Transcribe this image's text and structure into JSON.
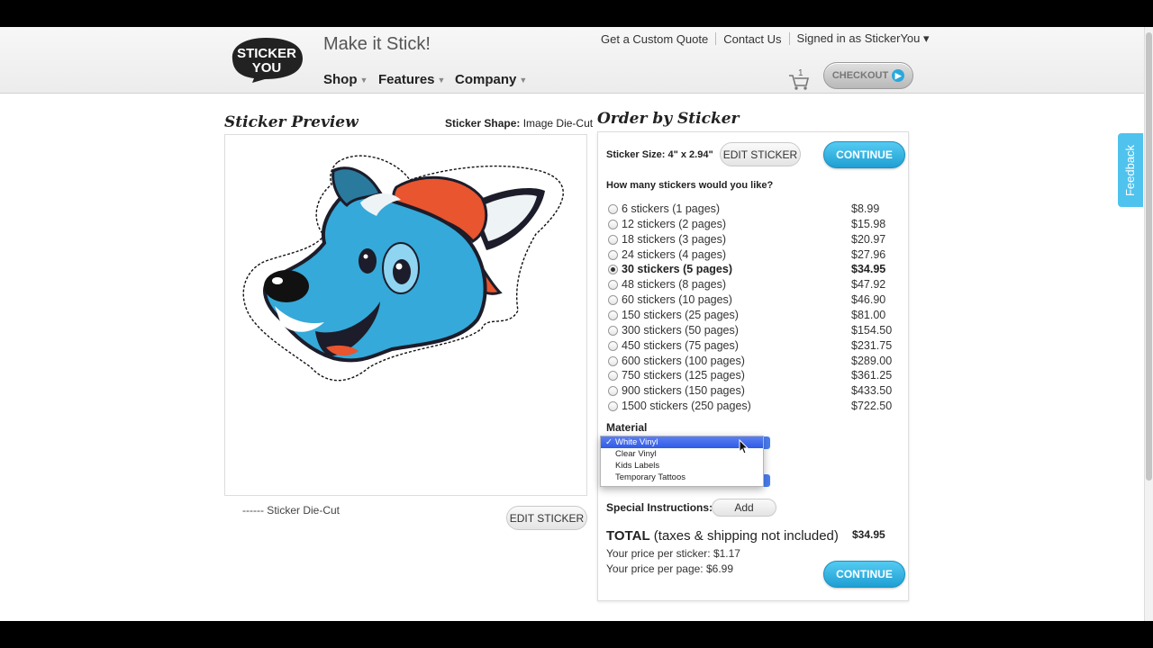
{
  "brand": {
    "logo_line1": "STICKER",
    "logo_line2": "YOU",
    "tagline": "Make it Stick!"
  },
  "nav": {
    "shop": "Shop",
    "features": "Features",
    "company": "Company"
  },
  "top_links": {
    "quote": "Get a Custom Quote",
    "contact": "Contact Us",
    "signed_in": "Signed in as StickerYou ▾"
  },
  "cart": {
    "count": "1",
    "checkout_label": "CHECKOUT"
  },
  "feedback_label": "Feedback",
  "preview": {
    "title": "Sticker Preview",
    "shape_key": "Sticker Shape:",
    "shape_value": "Image Die-Cut",
    "legend": "------ Sticker Die-Cut",
    "edit_button": "EDIT STICKER"
  },
  "order": {
    "title": "Order by Sticker",
    "size_label": "Sticker Size: 4\" x 2.94\"",
    "edit_button": "EDIT STICKER",
    "continue_label": "CONTINUE",
    "question": "How many stickers would you like?",
    "options": [
      {
        "label": "6 stickers (1 pages)",
        "price": "$8.99"
      },
      {
        "label": "12 stickers (2 pages)",
        "price": "$15.98"
      },
      {
        "label": "18 stickers (3 pages)",
        "price": "$20.97"
      },
      {
        "label": "24 stickers (4 pages)",
        "price": "$27.96"
      },
      {
        "label": "30 stickers (5 pages)",
        "price": "$34.95"
      },
      {
        "label": "48 stickers (8 pages)",
        "price": "$47.92"
      },
      {
        "label": "60 stickers (10 pages)",
        "price": "$46.90"
      },
      {
        "label": "150 stickers (25 pages)",
        "price": "$81.00"
      },
      {
        "label": "300 stickers (50 pages)",
        "price": "$154.50"
      },
      {
        "label": "450 stickers (75 pages)",
        "price": "$231.75"
      },
      {
        "label": "600 stickers (100 pages)",
        "price": "$289.00"
      },
      {
        "label": "750 stickers (125 pages)",
        "price": "$361.25"
      },
      {
        "label": "900 stickers (150 pages)",
        "price": "$433.50"
      },
      {
        "label": "1500 stickers (250 pages)",
        "price": "$722.50"
      }
    ],
    "selected_index": 4,
    "material_label": "Material",
    "material_options": [
      "White Vinyl",
      "Clear Vinyl",
      "Kids Labels",
      "Temporary Tattoos"
    ],
    "material_selected": "White Vinyl",
    "special_label": "Special Instructions:",
    "special_add": "Add",
    "total_bold": "TOTAL",
    "total_note": " (taxes & shipping not included)",
    "total_price": "$34.95",
    "per_sticker": "Your price per sticker: $1.17",
    "per_page": "Your price per page: $6.99"
  },
  "colors": {
    "accent_blue": "#29a8dd",
    "dog_blue": "#35a9d9",
    "cap_orange": "#e8552f"
  }
}
